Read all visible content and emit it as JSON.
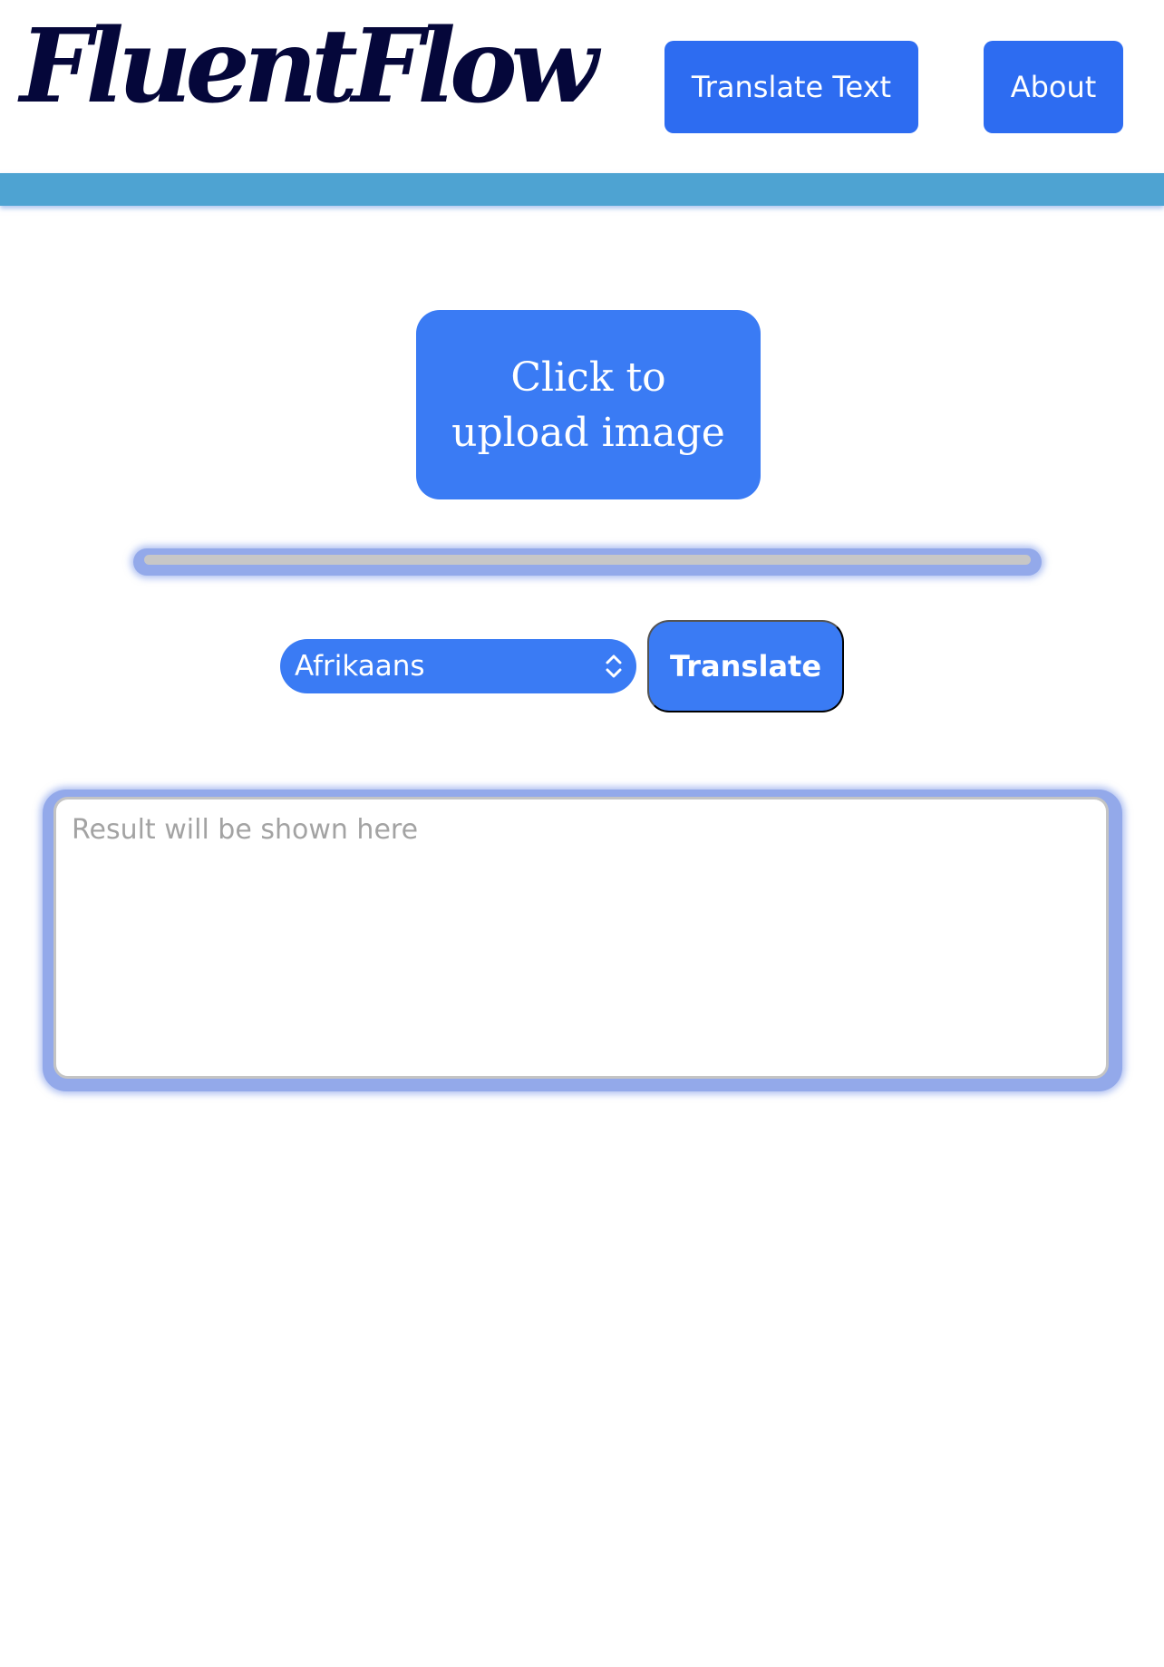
{
  "header": {
    "logo_text": "FluentFlow",
    "nav": {
      "translate_text_label": "Translate Text",
      "about_label": "About"
    }
  },
  "upload": {
    "label": "Click to upload image"
  },
  "progress": {
    "value_percent": 0
  },
  "controls": {
    "language_selected": "Afrikaans",
    "translate_label": "Translate"
  },
  "result": {
    "value": "",
    "placeholder": "Result will be shown here"
  },
  "colors": {
    "primary_button": "#2d6cf1",
    "accent_button": "#3a7bf4",
    "header_band": "#4ea3d2",
    "logo": "#05073a"
  },
  "icons": {
    "language_select": "chevron-up-down-icon"
  }
}
